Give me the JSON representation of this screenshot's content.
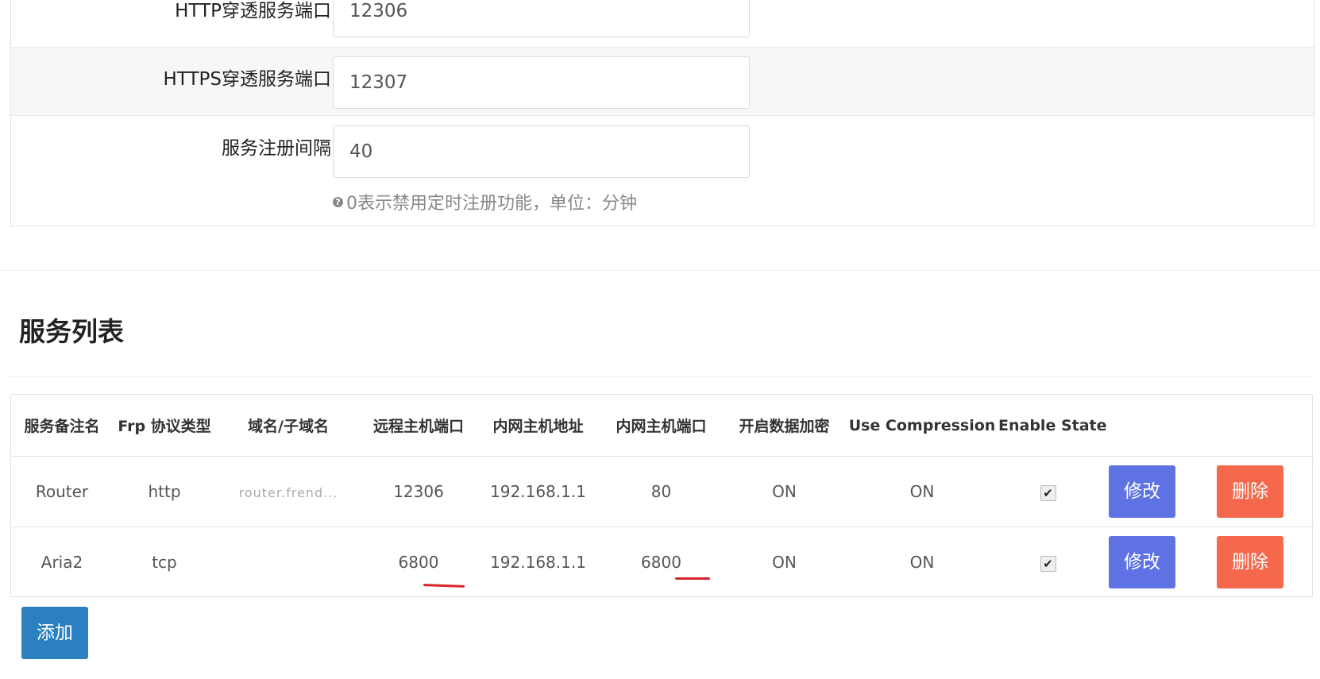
{
  "settings": {
    "http_port_label": "HTTP穿透服务端口",
    "http_port_value": "12306",
    "https_port_label": "HTTPS穿透服务端口",
    "https_port_value": "12307",
    "interval_label": "服务注册间隔",
    "interval_value": "40",
    "interval_help": "0表示禁用定时注册功能，单位：分钟"
  },
  "section_title": "服务列表",
  "table": {
    "headers": [
      "服务备注名",
      "Frp 协议类型",
      "域名/子域名",
      "远程主机端口",
      "内网主机地址",
      "内网主机端口",
      "开启数据加密",
      "Use Compression",
      "Enable State"
    ],
    "rows": [
      {
        "name": "Router",
        "protocol": "http",
        "domain": "router.frend...",
        "remote_port": "12306",
        "lan_addr": "192.168.1.1",
        "lan_port": "80",
        "encryption": "ON",
        "compression": "ON",
        "enabled": true,
        "edit_label": "修改",
        "delete_label": "删除"
      },
      {
        "name": "Aria2",
        "protocol": "tcp",
        "domain": "",
        "remote_port": "6800",
        "lan_addr": "192.168.1.1",
        "lan_port": "6800",
        "encryption": "ON",
        "compression": "ON",
        "enabled": true,
        "edit_label": "修改",
        "delete_label": "删除"
      }
    ]
  },
  "add_label": "添加",
  "colors": {
    "edit": "#5e72e4",
    "delete": "#f5684b",
    "add": "#2b80c2",
    "annotation": "#d8232a"
  }
}
